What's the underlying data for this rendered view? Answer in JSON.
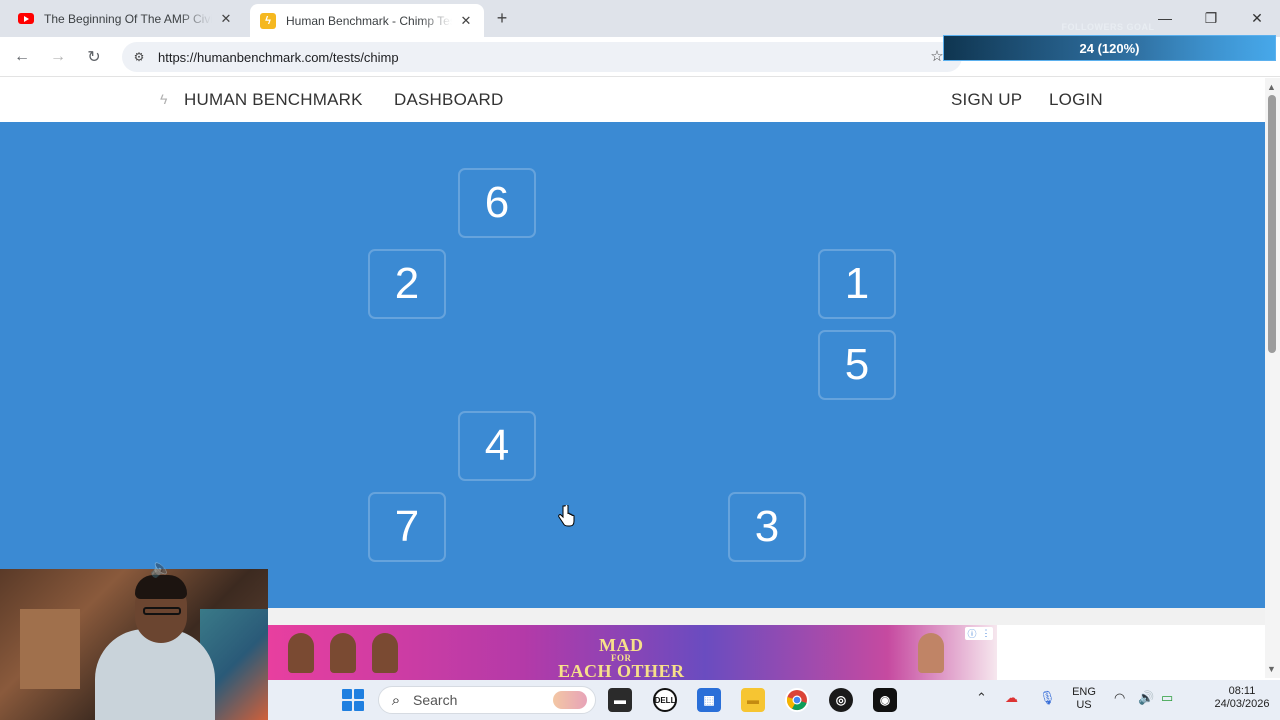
{
  "browser": {
    "tabs": [
      {
        "title": "The Beginning Of The AMP Civi",
        "favicon": "youtube-icon",
        "active": false
      },
      {
        "title": "Human Benchmark - Chimp Tes",
        "favicon": "lightning-icon",
        "active": true
      }
    ],
    "new_tab_label": "+",
    "url": "https://humanbenchmark.com/tests/chimp",
    "window_controls": {
      "minimize": "—",
      "restore": "❐",
      "close": "✕"
    }
  },
  "overlay": {
    "goal_title": "FOLLOWERS GOAL",
    "goal_value": "24 (120%)",
    "goal_progress": 1.0
  },
  "site_header": {
    "brand": "HUMAN BENCHMARK",
    "dashboard": "DASHBOARD",
    "sign_up": "SIGN UP",
    "login": "LOGIN"
  },
  "game": {
    "background": "#3b8ad3",
    "cells": [
      {
        "label": "6"
      },
      {
        "label": "2"
      },
      {
        "label": "1"
      },
      {
        "label": "5"
      },
      {
        "label": "4"
      },
      {
        "label": "7"
      },
      {
        "label": "3"
      }
    ]
  },
  "ad": {
    "headline_line1": "MAD",
    "headline_line2": "FOR",
    "headline_line3": "EACH OTHER",
    "info_icon": "ⓘ",
    "menu_icon": "⋮"
  },
  "taskbar": {
    "search_placeholder": "Search",
    "language_line1": "ENG",
    "language_line2": "US",
    "time": "08:11",
    "date": "24/03/2026"
  }
}
